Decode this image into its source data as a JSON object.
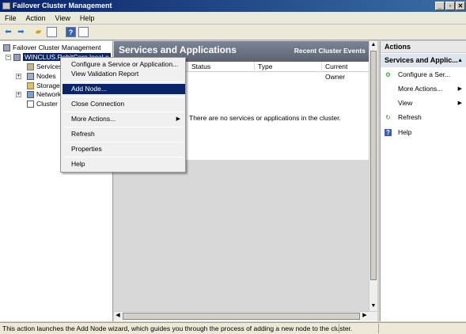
{
  "window": {
    "title": "Failover Cluster Management",
    "controls": {
      "minimize": "_",
      "restore": "▫",
      "close": "✕"
    }
  },
  "menu": [
    "File",
    "Action",
    "View",
    "Help"
  ],
  "toolbar": {
    "icons": [
      "back-icon",
      "forward-icon",
      "up-folder-icon",
      "show-hide-tree-icon",
      "help-icon",
      "properties-icon"
    ]
  },
  "tree": {
    "root": "Failover Cluster Management",
    "cluster": "WINCLUS.RobitCorp.local",
    "cluster_visible": "WINCLUS.RobitCorp.local.e",
    "children": [
      "Services",
      "Nodes",
      "Storage",
      "Network",
      "Cluster"
    ]
  },
  "center": {
    "title": "Services and Applications",
    "recent_events": "Recent Cluster Events",
    "columns": [
      "Status",
      "Type",
      "Current Owner"
    ],
    "empty_message": "There are no services or applications in the cluster."
  },
  "context_menu": {
    "items": [
      {
        "label": "Configure a Service or Application..."
      },
      {
        "label": "View Validation Report"
      },
      {
        "label": "Add Node...",
        "highlighted": true
      },
      {
        "label": "Close Connection"
      },
      {
        "label": "More Actions...",
        "submenu": true
      },
      {
        "label": "Refresh"
      },
      {
        "label": "Properties"
      },
      {
        "label": "Help"
      }
    ]
  },
  "actions": {
    "header": "Actions",
    "section": "Services and Applic...",
    "items": [
      {
        "label": "Configure a Ser...",
        "icon": "configure-icon"
      },
      {
        "label": "More Actions...",
        "submenu": true
      },
      {
        "label": "View",
        "submenu": true
      },
      {
        "label": "Refresh",
        "icon": "refresh-icon"
      },
      {
        "label": "Help",
        "icon": "help-icon"
      }
    ]
  },
  "status_bar": {
    "text": "This action launches the Add Node wizard, which guides you through the process of adding a new node to the cluster."
  }
}
